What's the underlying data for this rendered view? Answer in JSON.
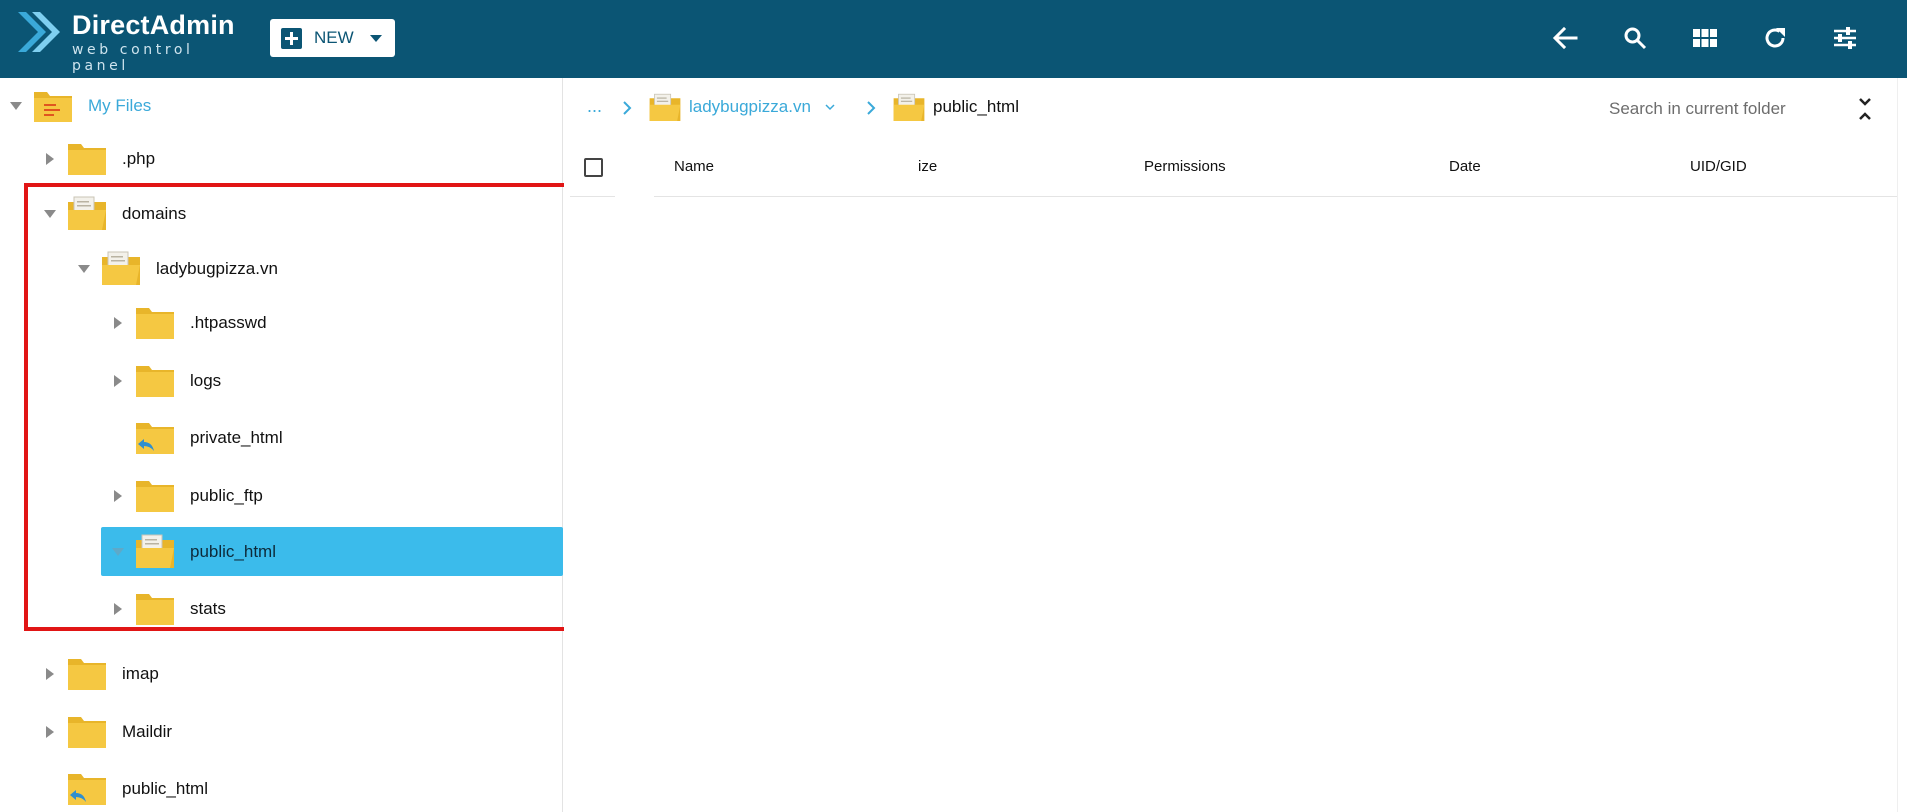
{
  "app": {
    "logo_title": "DirectAdmin",
    "logo_subtitle": "web control panel",
    "new_button_label": "NEW",
    "toolbar_icons": [
      "back-arrow-icon",
      "search-icon",
      "grid-view-icon",
      "refresh-icon",
      "settings-sliders-icon"
    ]
  },
  "colors": {
    "topbar": "#0b5574",
    "accent": "#3aa9d9",
    "selected": "#3bbbeb",
    "folder": "#f5c842",
    "folder_dark": "#e8b52a",
    "highlight": "#e11515"
  },
  "tree": {
    "root_label": "My Files",
    "items": [
      {
        "label": ".php"
      },
      {
        "label": "domains"
      },
      {
        "label": "ladybugpizza.vn"
      },
      {
        "label": ".htpasswd"
      },
      {
        "label": "logs"
      },
      {
        "label": "private_html"
      },
      {
        "label": "public_ftp"
      },
      {
        "label": "public_html"
      },
      {
        "label": "stats"
      },
      {
        "label": "imap"
      },
      {
        "label": "Maildir"
      },
      {
        "label": "public_html"
      }
    ]
  },
  "breadcrumb": {
    "ellipsis": "...",
    "parent": "ladybugpizza.vn",
    "current": "public_html"
  },
  "search": {
    "placeholder": "Search in current folder"
  },
  "table": {
    "columns": [
      "Name",
      "ize",
      "Permissions",
      "Date",
      "UID/GID"
    ]
  }
}
